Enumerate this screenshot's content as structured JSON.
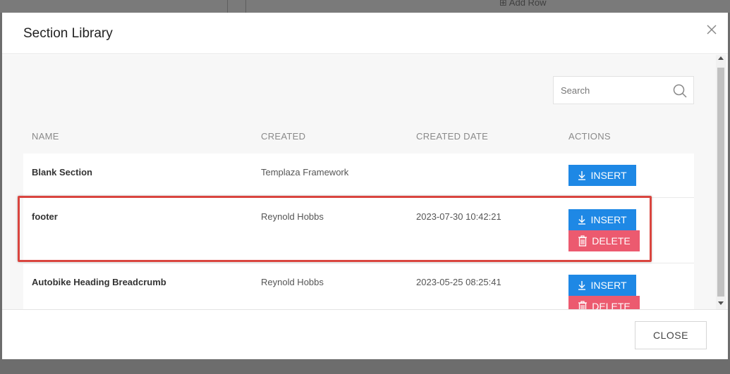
{
  "background": {
    "add_row_label": "Add Row"
  },
  "modal": {
    "title": "Section Library",
    "close_icon": "close-icon",
    "search": {
      "placeholder": "Search",
      "value": ""
    },
    "columns": {
      "name": "NAME",
      "created": "CREATED",
      "created_date": "CREATED DATE",
      "actions": "ACTIONS"
    },
    "rows": [
      {
        "name": "Blank Section",
        "created": "Templaza Framework",
        "created_date": "",
        "insert_label": "INSERT"
      },
      {
        "name": "footer",
        "created": "Reynold Hobbs",
        "created_date": "2023-07-30 10:42:21",
        "insert_label": "INSERT",
        "delete_label": "DELETE"
      },
      {
        "name": "Autobike Heading Breadcrumb",
        "created": "Reynold Hobbs",
        "created_date": "2023-05-25 08:25:41",
        "insert_label": "INSERT",
        "delete_label": "DELETE"
      }
    ],
    "footer": {
      "close_label": "CLOSE"
    }
  },
  "colors": {
    "insert": "#1e88e5",
    "delete": "#ec5a6f",
    "highlight": "#d9453f"
  }
}
